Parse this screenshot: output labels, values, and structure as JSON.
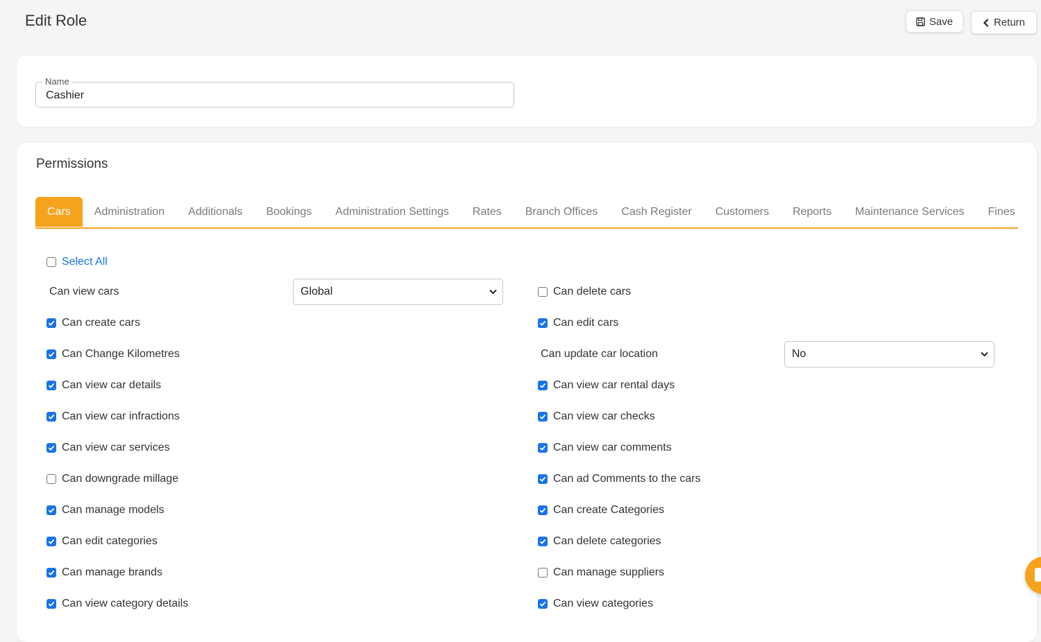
{
  "page": {
    "title": "Edit Role"
  },
  "header": {
    "save_label": "Save",
    "return_label": "Return"
  },
  "name_field": {
    "label": "Name",
    "value": "Cashier"
  },
  "permissions": {
    "title": "Permissions",
    "tabs": [
      "Cars",
      "Administration",
      "Additionals",
      "Bookings",
      "Administration Settings",
      "Rates",
      "Branch Offices",
      "Cash Register",
      "Customers",
      "Reports",
      "Maintenance Services",
      "Fines"
    ],
    "active_tab": "Cars",
    "select_all": {
      "label": "Select All",
      "checked": false
    },
    "left": [
      {
        "label": "Can view cars",
        "type": "select",
        "value": "Global"
      },
      {
        "label": "Can create cars",
        "checked": true
      },
      {
        "label": "Can Change Kilometres",
        "checked": true
      },
      {
        "label": "Can view car details",
        "checked": true
      },
      {
        "label": "Can view car infractions",
        "checked": true
      },
      {
        "label": "Can view car services",
        "checked": true
      },
      {
        "label": "Can downgrade millage",
        "checked": false
      },
      {
        "label": "Can manage models",
        "checked": true
      },
      {
        "label": "Can edit categories",
        "checked": true
      },
      {
        "label": "Can manage brands",
        "checked": true
      },
      {
        "label": "Can view category details",
        "checked": true
      }
    ],
    "right": [
      {
        "label": "Can delete cars",
        "checked": false
      },
      {
        "label": "Can edit cars",
        "checked": true
      },
      {
        "label": "Can update car location",
        "type": "select",
        "value": "No"
      },
      {
        "label": "Can view car rental days",
        "checked": true
      },
      {
        "label": "Can view car checks",
        "checked": true
      },
      {
        "label": "Can view car comments",
        "checked": true
      },
      {
        "label": "Can ad Comments to the cars",
        "checked": true
      },
      {
        "label": "Can create Categories",
        "checked": true
      },
      {
        "label": "Can delete categories",
        "checked": true
      },
      {
        "label": "Can manage suppliers",
        "checked": false
      },
      {
        "label": "Can view categories",
        "checked": true
      }
    ]
  },
  "colors": {
    "accent": "#f5a21c",
    "checkbox": "#1a73e8",
    "link": "#1a73e8"
  },
  "icons": {
    "save": "floppy-disk-icon",
    "return": "chevron-left-icon",
    "select": "chevron-down-icon",
    "chat": "chat-bubble-icon"
  }
}
